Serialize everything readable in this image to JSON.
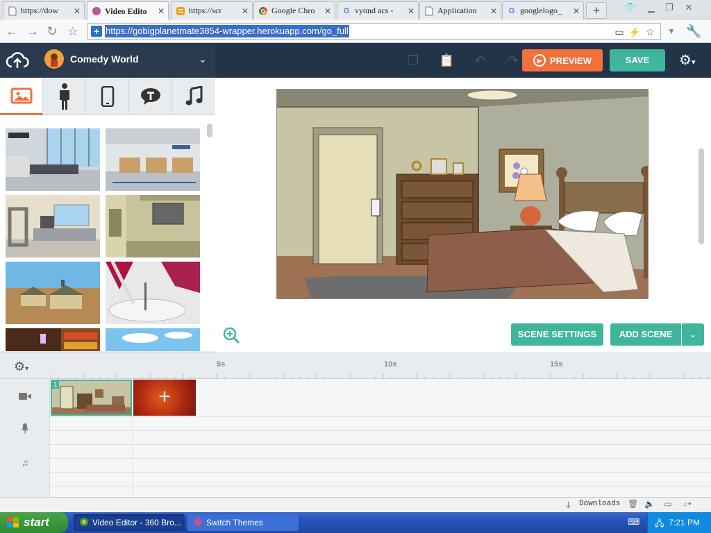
{
  "browser": {
    "tabs": [
      {
        "title": "https://dow",
        "favicon": "page-icon",
        "active": false
      },
      {
        "title": "Video Edito",
        "favicon": "vyond-icon",
        "active": true
      },
      {
        "title": "https://scr",
        "favicon": "blogger-icon",
        "active": false
      },
      {
        "title": "Google Chro",
        "favicon": "chrome-icon",
        "active": false
      },
      {
        "title": "vyond acs -",
        "favicon": "google-icon",
        "active": false
      },
      {
        "title": "Application",
        "favicon": "page-icon",
        "active": false
      },
      {
        "title": "googlelogo_",
        "favicon": "google-icon",
        "active": false
      }
    ],
    "new_tab": "+",
    "url": "https://gobigplanetmate3854-wrapper.herokuapp.com/go_full"
  },
  "app": {
    "theme_name": "Comedy World",
    "preview_label": "PREVIEW",
    "save_label": "SAVE",
    "asset_tabs": [
      "backgrounds",
      "characters",
      "props",
      "text",
      "music"
    ],
    "scene_settings_label": "SCENE SETTINGS",
    "add_scene_label": "ADD SCENE",
    "colors": {
      "accent_orange": "#f2713a",
      "accent_teal": "#3fb59c",
      "header_dark": "#223448"
    }
  },
  "timeline": {
    "ticks": [
      "5s",
      "10s",
      "15s"
    ],
    "scene_number": "1",
    "add_tile": "+"
  },
  "downloads": {
    "label": "Downloads"
  },
  "taskbar": {
    "start_label": "start",
    "items": [
      "Video Editor - 360 Bro...",
      "Switch Themes"
    ],
    "clock": "7:21 PM"
  }
}
